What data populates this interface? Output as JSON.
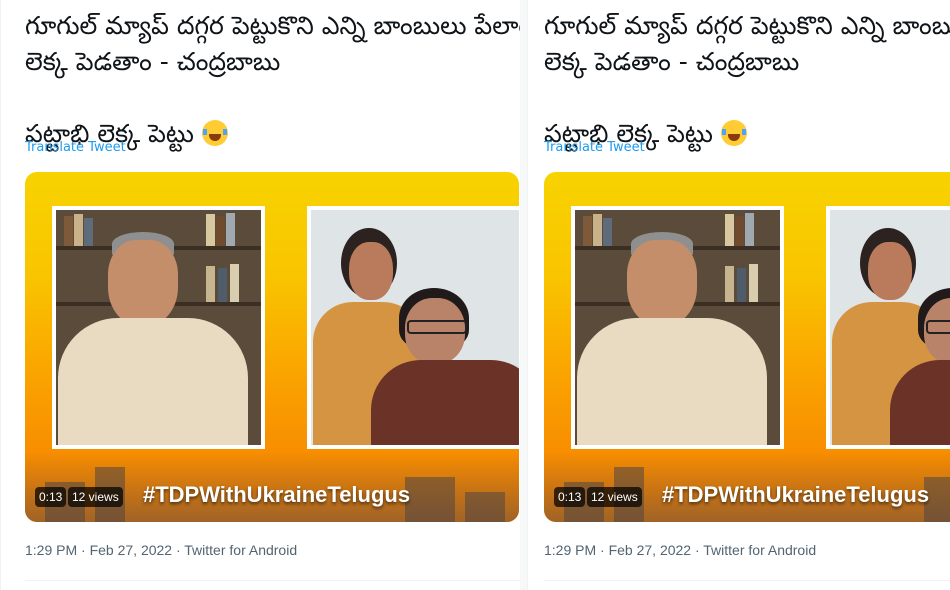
{
  "tweet": {
    "line1": "గూగుల్ మ్యాప్ దగ్గర పెట్టుకొని ఎన్ని బాంబులు పేలాయో",
    "line2": "లెక్క పెడతాం - చంద్రబాబు",
    "line3": "పట్టాభి లెక్క పెట్టు",
    "emoji": "face-with-tears-of-joy-icon",
    "translate_label": "Translate Tweet",
    "media": {
      "hashtag": "#TDPWithUkraineTelugus",
      "duration": "0:13",
      "views": "12 views"
    },
    "meta": "1:29 PM · Feb 27, 2022 · Twitter for Android"
  },
  "colors": {
    "text": "#0f1419",
    "link": "#1d9bf0",
    "secondary": "#536471",
    "banner_top": "#f7d300",
    "banner_bottom": "#f57b00"
  }
}
